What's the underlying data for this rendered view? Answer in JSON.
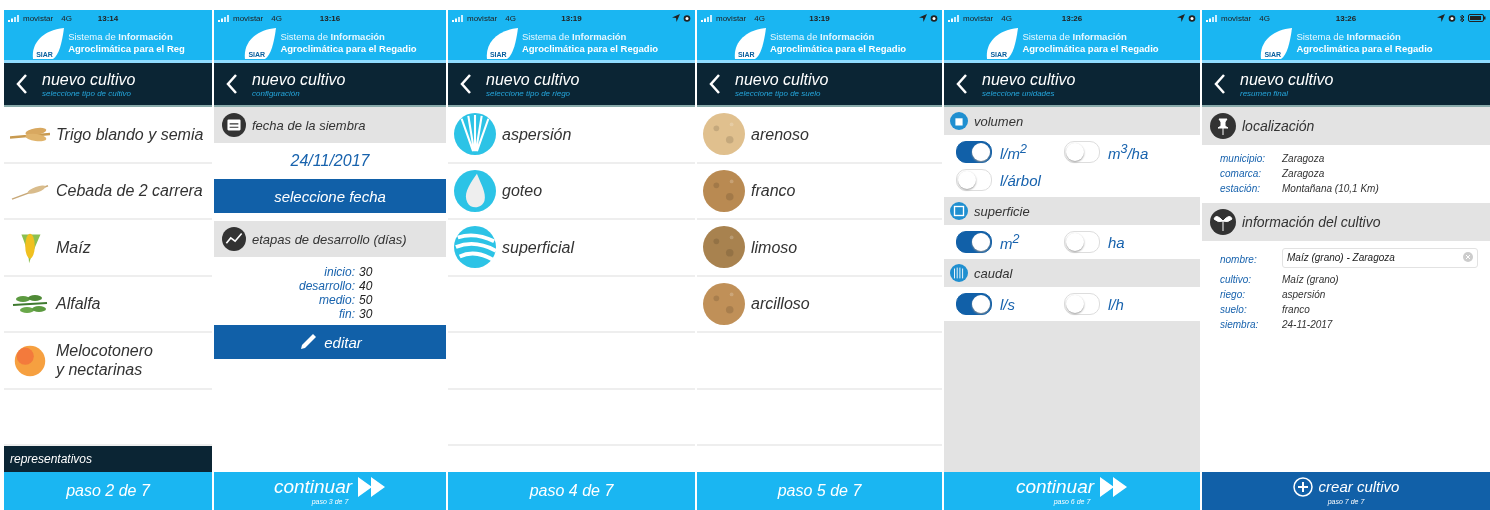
{
  "phones": [
    {
      "status": {
        "carrier": "movistar",
        "network": "4G",
        "time": "13:14",
        "location": false,
        "alarm": false,
        "bluetooth": false,
        "battery": false
      },
      "logo": {
        "mark": "SIAR",
        "line1": "Sistema de **Información**",
        "line2": "Agroclimática para el Reg"
      },
      "header": {
        "title": "nuevo cultivo",
        "subtitle": "seleccione tipo de cultivo"
      },
      "body": {
        "kind": "list",
        "items": [
          {
            "label": "Trigo blando y semia",
            "kind": "wheat"
          },
          {
            "label": "Cebada de 2 carrera",
            "kind": "barley"
          },
          {
            "label": "Maíz",
            "kind": "corn"
          },
          {
            "label": "Alfalfa",
            "kind": "alfalfa"
          },
          {
            "label": "Melocotonero\ny nectarinas",
            "kind": "peach"
          }
        ],
        "section_bar": "representativos"
      },
      "footer": {
        "kind": "step",
        "label": "paso 2 de 7"
      }
    },
    {
      "status": {
        "carrier": "movistar",
        "network": "4G",
        "time": "13:16",
        "location": false,
        "alarm": false,
        "bluetooth": false,
        "battery": false
      },
      "logo": {
        "mark": "SIAR",
        "line1": "Sistema de **Información**",
        "line2": "Agroclimática para el Regadio"
      },
      "header": {
        "title": "nuevo cultivo",
        "subtitle": "configuración"
      },
      "body": {
        "kind": "config",
        "blocks": [
          {
            "kind": "date-section",
            "title": "fecha de la siembra"
          },
          {
            "kind": "value",
            "text": "24/11/2017"
          },
          {
            "kind": "date-button",
            "label": "seleccione fecha"
          },
          {
            "kind": "stages-section",
            "title": "etapas de desarrollo (días)"
          },
          {
            "kind": "stages",
            "rows": [
              {
                "label": "inicio:",
                "value": "30"
              },
              {
                "label": "desarrollo:",
                "value": "40"
              },
              {
                "label": "medio:",
                "value": "50"
              },
              {
                "label": "fin:",
                "value": "30"
              }
            ]
          },
          {
            "kind": "edit-button",
            "label": "editar"
          }
        ]
      },
      "footer": {
        "kind": "continue",
        "label": "continuar",
        "sub": "paso 3 de 7"
      }
    },
    {
      "status": {
        "carrier": "movistar",
        "network": "4G",
        "time": "13:19",
        "location": true,
        "alarm": true,
        "bluetooth": false,
        "battery": false
      },
      "logo": {
        "mark": "SIAR",
        "line1": "Sistema de **Información**",
        "line2": "Agroclimática para el Regadio"
      },
      "header": {
        "title": "nuevo cultivo",
        "subtitle": "seleccione tipo de riego"
      },
      "body": {
        "kind": "list",
        "items": [
          {
            "label": "aspersión",
            "kind": "sprinkler"
          },
          {
            "label": "goteo",
            "kind": "drip"
          },
          {
            "label": "superficial",
            "kind": "surface"
          }
        ]
      },
      "footer": {
        "kind": "step",
        "label": "paso 4 de 7"
      }
    },
    {
      "status": {
        "carrier": "movistar",
        "network": "4G",
        "time": "13:19",
        "location": true,
        "alarm": true,
        "bluetooth": false,
        "battery": false
      },
      "logo": {
        "mark": "SIAR",
        "line1": "Sistema de **Información**",
        "line2": "Agroclimática para el Regadio"
      },
      "header": {
        "title": "nuevo cultivo",
        "subtitle": "seleccione tipo de suelo"
      },
      "body": {
        "kind": "list",
        "items": [
          {
            "label": "arenoso",
            "kind": "sand"
          },
          {
            "label": "franco",
            "kind": "loam"
          },
          {
            "label": "limoso",
            "kind": "silt"
          },
          {
            "label": "arcilloso",
            "kind": "clay"
          }
        ]
      },
      "footer": {
        "kind": "step",
        "label": "paso 5 de 7"
      }
    },
    {
      "status": {
        "carrier": "movistar",
        "network": "4G",
        "time": "13:26",
        "location": true,
        "alarm": true,
        "bluetooth": false,
        "battery": false
      },
      "logo": {
        "mark": "SIAR",
        "line1": "Sistema de **Información**",
        "line2": "Agroclimática para el Regadio"
      },
      "header": {
        "title": "nuevo cultivo",
        "subtitle": "seleccione unidades"
      },
      "body": {
        "kind": "units",
        "groups": [
          {
            "title": "volumen",
            "kind": "volume",
            "options": [
              {
                "label": "l/m$^{2}$",
                "on": true
              },
              {
                "label": "m$^{3}$/ha",
                "on": false
              },
              {
                "label": "l/árbol",
                "on": false
              }
            ]
          },
          {
            "title": "superficie",
            "kind": "area",
            "options": [
              {
                "label": "m$^{2}$",
                "on": true
              },
              {
                "label": "ha",
                "on": false
              }
            ]
          },
          {
            "title": "caudal",
            "kind": "flow",
            "options": [
              {
                "label": "l/s",
                "on": true
              },
              {
                "label": "l/h",
                "on": false
              }
            ]
          }
        ]
      },
      "footer": {
        "kind": "continue",
        "label": "continuar",
        "sub": "paso 6 de 7"
      }
    },
    {
      "status": {
        "carrier": "movistar",
        "network": "4G",
        "time": "13:26",
        "location": true,
        "alarm": true,
        "bluetooth": true,
        "battery": true
      },
      "logo": {
        "mark": "SIAR",
        "line1": "Sistema de **Información**",
        "line2": "Agroclimática para el Regadio"
      },
      "header": {
        "title": "nuevo cultivo",
        "subtitle": "resumen final"
      },
      "body": {
        "kind": "summary",
        "sections": [
          {
            "title": "localización",
            "kind": "location",
            "rows": [
              {
                "label": "municipio:",
                "value": "Zaragoza"
              },
              {
                "label": "comarca:",
                "value": "Zaragoza"
              },
              {
                "label": "estación:",
                "value": "Montañana (10,1 Km)"
              }
            ]
          },
          {
            "title": "información del cultivo",
            "kind": "crop",
            "field": {
              "label": "nombre:",
              "value": "Maíz (grano) - Zaragoza"
            },
            "rows": [
              {
                "label": "cultivo:",
                "value": "Maíz (grano)"
              },
              {
                "label": "riego:",
                "value": "aspersión"
              },
              {
                "label": "suelo:",
                "value": "franco"
              },
              {
                "label": "siembra:",
                "value": "24-11-2017"
              }
            ]
          }
        ]
      },
      "footer": {
        "kind": "create",
        "label": "crear cultivo",
        "sub": "paso 7 de 7"
      }
    }
  ]
}
